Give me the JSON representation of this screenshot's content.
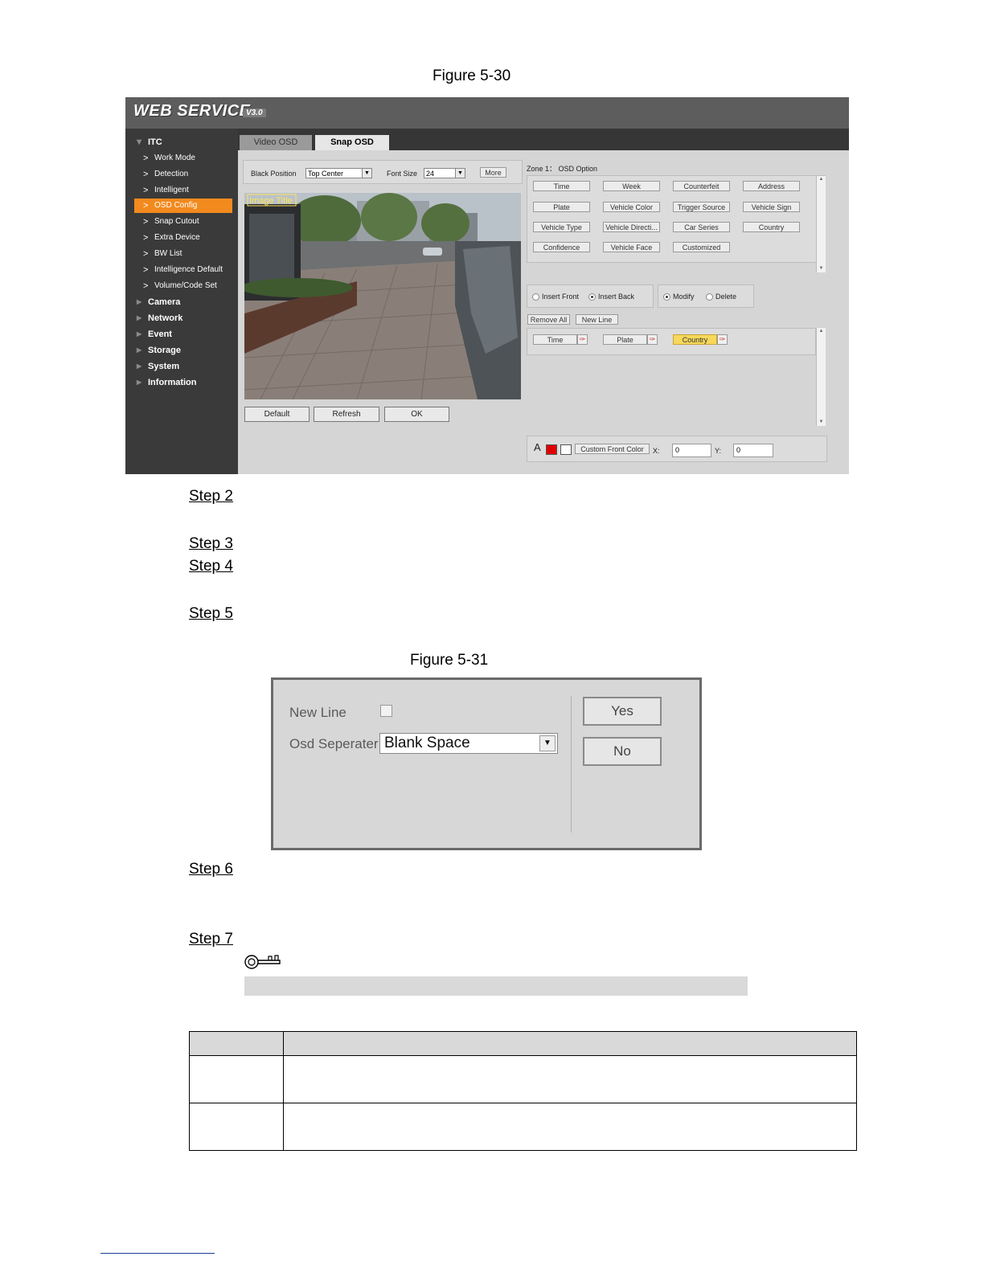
{
  "figures": {
    "fig1_caption": "Figure 5-30",
    "fig2_caption": "Figure 5-31"
  },
  "ws": {
    "logo": "WEB  SERVICE",
    "version": "V3.0",
    "tabs": [
      "Video OSD",
      "Snap OSD"
    ],
    "sidebar": {
      "itc": "ITC",
      "sub_items": [
        "Work Mode",
        "Detection",
        "Intelligent",
        "OSD Config",
        "Snap Cutout",
        "Extra Device",
        "BW List",
        "Intelligence Default",
        "Volume/Code Set"
      ],
      "groups": [
        "Camera",
        "Network",
        "Event",
        "Storage",
        "System",
        "Information"
      ]
    },
    "toolbar": {
      "block_position_label": "Black Position",
      "block_position_value": "Top Center",
      "font_size_label": "Font Size",
      "font_size_value": "24",
      "more_label": "More"
    },
    "image_title": "Image Title",
    "buttons": {
      "default": "Default",
      "refresh": "Refresh",
      "ok": "OK"
    },
    "zone_title": "Zone 1：  OSD Option",
    "osd_options": [
      "Time",
      "Week",
      "Counterfeit",
      "Address",
      "Plate",
      "Vehicle Color",
      "Trigger Source",
      "Vehicle Sign",
      "Vehicle Type",
      "Vehicle Directi...",
      "Car Series",
      "Country",
      "Confidence",
      "Vehicle Face",
      "Customized"
    ],
    "insert_front": "Insert Front",
    "insert_back": "Insert Back",
    "modify": "Modify",
    "delete": "Delete",
    "remove_all": "Remove All",
    "new_line": "New Line",
    "selected": [
      "Time",
      "Plate",
      "Country"
    ],
    "font_glyph": "A",
    "custom_font_color": "Custom Front Color",
    "x_label": "X:",
    "x_value": "0",
    "y_label": "Y:",
    "y_value": "0",
    "colors": {
      "red_swatch": "#e00000",
      "white_swatch": "#ffffff",
      "active_item": "#f28a1e",
      "selected_chip": "#f6d85a"
    }
  },
  "steps": [
    "Step 2",
    "Step 3",
    "Step 4",
    "Step 5",
    "Step 6",
    "Step 7"
  ],
  "dialog": {
    "new_line_label": "New Line",
    "separator_label": "Osd Seperater",
    "separator_value": "Blank Space",
    "yes": "Yes",
    "no": "No"
  }
}
